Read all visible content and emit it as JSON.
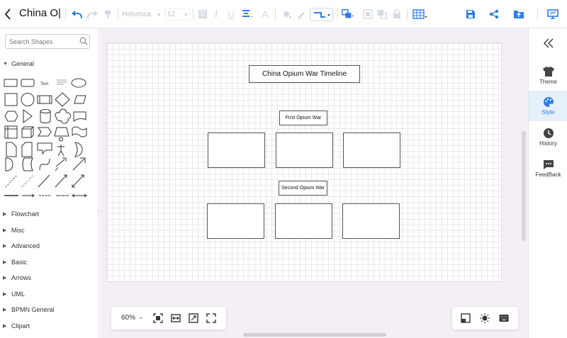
{
  "toolbar": {
    "back_icon": "chevron-left-icon",
    "doc_title": "China O|",
    "font_family": "Helvetica",
    "font_size": "12",
    "icons": [
      "undo-icon",
      "redo-icon",
      "format-painter-icon",
      "fill-color-icon",
      "bold-icon",
      "italic-icon",
      "underline-icon",
      "align-icon",
      "font-color-icon",
      "fill-bucket-icon",
      "pen-icon",
      "connector-icon",
      "arrange-icon",
      "group-icon",
      "ungroup-icon",
      "lock-icon",
      "table-icon",
      "save-icon",
      "share-icon",
      "export-icon",
      "present-icon"
    ]
  },
  "sidebar": {
    "search_placeholder": "Search Shapes",
    "general_label": "General",
    "text_shape_label": "Text",
    "categories": [
      "Flowchart",
      "Misc",
      "Advanced",
      "Basic",
      "Arrows",
      "UML",
      "BPMN General",
      "Clipart"
    ]
  },
  "canvas": {
    "title": "China Opium War Timeline",
    "first_label": "First Opium War",
    "second_label": "Second Opium War"
  },
  "zoom": {
    "value": "60%"
  },
  "right_panel": {
    "items": [
      {
        "label": "Theme",
        "icon": "shirt-icon"
      },
      {
        "label": "Style",
        "icon": "palette-icon"
      },
      {
        "label": "History",
        "icon": "clock-icon"
      },
      {
        "label": "FeedBack",
        "icon": "chat-icon"
      }
    ]
  },
  "colors": {
    "accent": "#2d7be5",
    "active_bg": "#e6f0fb",
    "canvas_bg": "#f3eff5"
  }
}
